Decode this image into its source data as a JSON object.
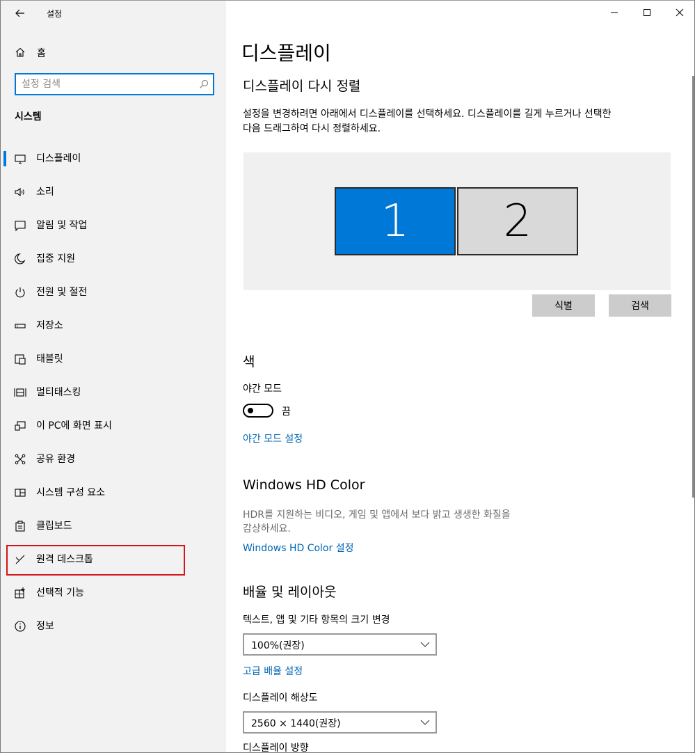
{
  "window": {
    "title": "설정"
  },
  "sidebar": {
    "home_label": "홈",
    "search_placeholder": "설정 검색",
    "section_title": "시스템",
    "items": [
      {
        "label": "디스플레이",
        "icon": "monitor-icon",
        "selected": true
      },
      {
        "label": "소리",
        "icon": "speaker-icon"
      },
      {
        "label": "알림 및 작업",
        "icon": "notification-icon"
      },
      {
        "label": "집중 지원",
        "icon": "moon-icon"
      },
      {
        "label": "전원 및 절전",
        "icon": "power-icon"
      },
      {
        "label": "저장소",
        "icon": "storage-icon"
      },
      {
        "label": "태블릿",
        "icon": "tablet-icon"
      },
      {
        "label": "멀티태스킹",
        "icon": "multitasking-icon"
      },
      {
        "label": "이 PC에 화면 표시",
        "icon": "project-icon"
      },
      {
        "label": "공유 환경",
        "icon": "shared-experiences-icon"
      },
      {
        "label": "시스템 구성 요소",
        "icon": "components-icon"
      },
      {
        "label": "클립보드",
        "icon": "clipboard-icon"
      },
      {
        "label": "원격 데스크톱",
        "icon": "remote-desktop-icon",
        "highlighted": true
      },
      {
        "label": "선택적 기능",
        "icon": "optional-features-icon"
      },
      {
        "label": "정보",
        "icon": "info-icon"
      }
    ]
  },
  "main": {
    "page_title": "디스플레이",
    "rearrange": {
      "heading": "디스플레이 다시 정렬",
      "description_line1": "설정을 변경하려면 아래에서 디스플레이를 선택하세요. 디스플레이를 길게 누르거나 선택한",
      "description_line2": "다음 드래그하여 다시 정렬하세요.",
      "monitor1": "1",
      "monitor2": "2",
      "identify_button": "식별",
      "detect_button": "검색"
    },
    "color": {
      "heading": "색",
      "night_light_label": "야간 모드",
      "night_light_state": "끔",
      "night_light_settings_link": "야간 모드 설정"
    },
    "hdr": {
      "heading": "Windows HD Color",
      "description_line1": "HDR를 지원하는 비디오, 게임 및 앱에서 보다 밝고 생생한 화질을",
      "description_line2": "감상하세요.",
      "settings_link": "Windows HD Color 설정"
    },
    "scale": {
      "heading": "배율 및 레이아웃",
      "scale_label": "텍스트, 앱 및 기타 항목의 크기 변경",
      "scale_value": "100%(권장)",
      "advanced_link": "고급 배율 설정",
      "resolution_label": "디스플레이 해상도",
      "resolution_value": "2560 × 1440(권장)",
      "orientation_label": "디스플레이 방향"
    }
  },
  "colors": {
    "accent": "#0078d7",
    "link": "#0066b4",
    "highlight_border": "#d4151b"
  }
}
